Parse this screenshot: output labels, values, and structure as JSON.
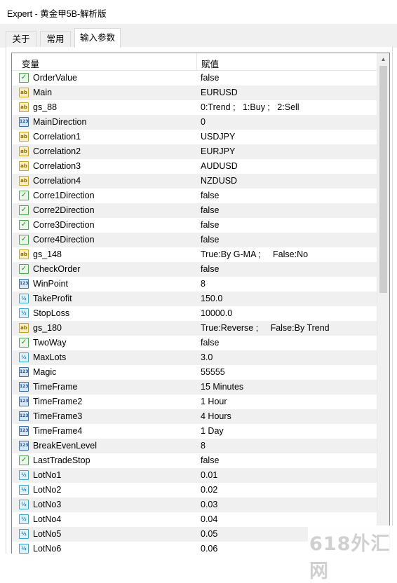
{
  "window": {
    "title": "Expert - 黄金甲5B-解析版"
  },
  "tabs": [
    {
      "label": "关于"
    },
    {
      "label": "常用"
    },
    {
      "label": "输入参数"
    }
  ],
  "grid": {
    "col_variable": "变量",
    "col_value": "赋值",
    "rows": [
      {
        "type": "bool",
        "name": "OrderValue",
        "value": "false"
      },
      {
        "type": "str",
        "name": "Main",
        "value": "EURUSD"
      },
      {
        "type": "str",
        "name": "gs_88",
        "value": "0:Trend ;   1:Buy ;   2:Sell"
      },
      {
        "type": "int",
        "name": "MainDirection",
        "value": "0"
      },
      {
        "type": "str",
        "name": "Correlation1",
        "value": "USDJPY"
      },
      {
        "type": "str",
        "name": "Correlation2",
        "value": "EURJPY"
      },
      {
        "type": "str",
        "name": "Correlation3",
        "value": "AUDUSD"
      },
      {
        "type": "str",
        "name": "Correlation4",
        "value": "NZDUSD"
      },
      {
        "type": "bool",
        "name": "Corre1Direction",
        "value": "false"
      },
      {
        "type": "bool",
        "name": "Corre2Direction",
        "value": "false"
      },
      {
        "type": "bool",
        "name": "Corre3Direction",
        "value": "false"
      },
      {
        "type": "bool",
        "name": "Corre4Direction",
        "value": "false"
      },
      {
        "type": "str",
        "name": "gs_148",
        "value": "True:By G-MA ;     False:No"
      },
      {
        "type": "bool",
        "name": "CheckOrder",
        "value": "false"
      },
      {
        "type": "int",
        "name": "WinPoint",
        "value": "8"
      },
      {
        "type": "dbl",
        "name": "TakeProfit",
        "value": "150.0"
      },
      {
        "type": "dbl",
        "name": "StopLoss",
        "value": "10000.0"
      },
      {
        "type": "str",
        "name": "gs_180",
        "value": "True:Reverse ;     False:By Trend"
      },
      {
        "type": "bool",
        "name": "TwoWay",
        "value": "false"
      },
      {
        "type": "dbl",
        "name": "MaxLots",
        "value": "3.0"
      },
      {
        "type": "int",
        "name": "Magic",
        "value": "55555"
      },
      {
        "type": "int",
        "name": "TimeFrame",
        "value": "15 Minutes"
      },
      {
        "type": "int",
        "name": "TimeFrame2",
        "value": "1 Hour"
      },
      {
        "type": "int",
        "name": "TimeFrame3",
        "value": "4 Hours"
      },
      {
        "type": "int",
        "name": "TimeFrame4",
        "value": "1 Day"
      },
      {
        "type": "int",
        "name": "BreakEvenLevel",
        "value": "8"
      },
      {
        "type": "bool",
        "name": "LastTradeStop",
        "value": "false"
      },
      {
        "type": "dbl",
        "name": "LotNo1",
        "value": "0.01"
      },
      {
        "type": "dbl",
        "name": "LotNo2",
        "value": "0.02"
      },
      {
        "type": "dbl",
        "name": "LotNo3",
        "value": "0.03"
      },
      {
        "type": "dbl",
        "name": "LotNo4",
        "value": "0.04"
      },
      {
        "type": "dbl",
        "name": "LotNo5",
        "value": "0.05"
      },
      {
        "type": "dbl",
        "name": "LotNo6",
        "value": "0.06"
      }
    ]
  },
  "icons": {
    "bool": "bool-type-icon",
    "str": "string-type-icon",
    "int": "integer-type-icon",
    "dbl": "double-type-icon"
  },
  "icon_glyphs": {
    "bool": "✓",
    "str": "ab",
    "int": "123",
    "dbl": "½"
  },
  "watermark": {
    "text": "618外汇网"
  }
}
